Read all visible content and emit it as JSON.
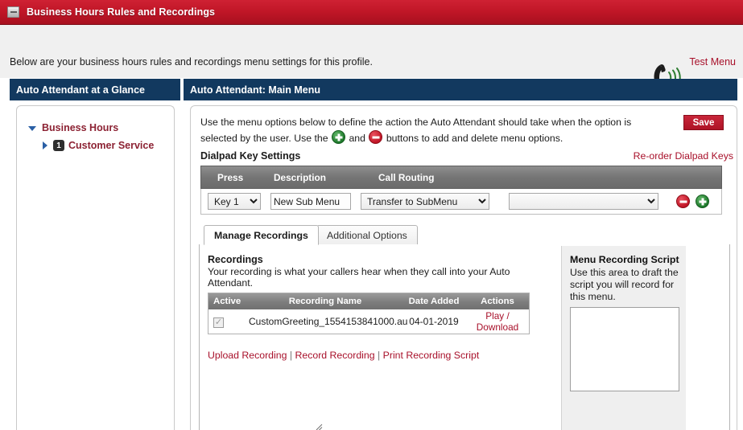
{
  "window": {
    "title": "Business Hours Rules and Recordings",
    "minimize_icon": "minimize-icon",
    "titlebar_color": "#c01627"
  },
  "intro": {
    "text": "Below are your business hours rules and recordings menu settings for this profile.",
    "test_menu_label": "Test Menu",
    "phone_icon": "phone-ringing-icon"
  },
  "left_column": {
    "header": "Auto Attendant at a Glance",
    "tree": [
      {
        "label": "Business Hours",
        "arrow": "chevron-down-icon",
        "badge": ""
      },
      {
        "label": "Customer Service",
        "arrow": "chevron-right-icon",
        "badge": "1"
      }
    ]
  },
  "main": {
    "header": "Auto Attendant: Main Menu",
    "instruction_line1": "Use the menu options below to define the action the Auto Attendant should take when the option is",
    "instruction_line2a": "selected by the user. Use the",
    "instruction_line2b": "and",
    "instruction_line2c": "buttons to add and delete menu options.",
    "save_label": "Save",
    "section_title": "Dialpad Key Settings",
    "reorder_label": "Re-order Dialpad Keys",
    "table": {
      "columns": [
        "Press",
        "Description",
        "Call Routing",
        ""
      ],
      "rows": [
        {
          "press_value": "Key 1",
          "press_options": [
            "Key 1"
          ],
          "description_value": "New Sub Menu",
          "description_placeholder": "",
          "routing_value": "Transfer to SubMenu",
          "routing_options": [
            "Transfer to SubMenu"
          ],
          "destination_value": "",
          "destination_options": [
            ""
          ],
          "delete_icon": "minus-circle-icon",
          "add_icon": "plus-circle-icon"
        }
      ]
    },
    "tabs": [
      {
        "label": "Manage Recordings",
        "active": true
      },
      {
        "label": "Additional Options",
        "active": false
      }
    ],
    "recordings": {
      "title": "Recordings",
      "subtitle": "Your recording is what your callers hear when they call into your Auto Attendant.",
      "columns": [
        "Active",
        "Recording Name",
        "Date Added",
        "Actions"
      ],
      "rows": [
        {
          "active": true,
          "name": "CustomGreeting_1554153841000.au",
          "date_added": "04-01-2019",
          "action_label": "Play / Download",
          "checkbox_icon": "checkbox-checked-icon"
        }
      ],
      "links": [
        "Upload Recording",
        "Record Recording",
        "Print Recording Script"
      ],
      "link_separator": "|"
    },
    "script_panel": {
      "title": "Menu Recording Script",
      "description": "Use this area to draft the script you will record for this menu.",
      "textarea_value": "",
      "textarea_placeholder": "",
      "resize_grip_icon": "resize-grip-icon"
    }
  }
}
